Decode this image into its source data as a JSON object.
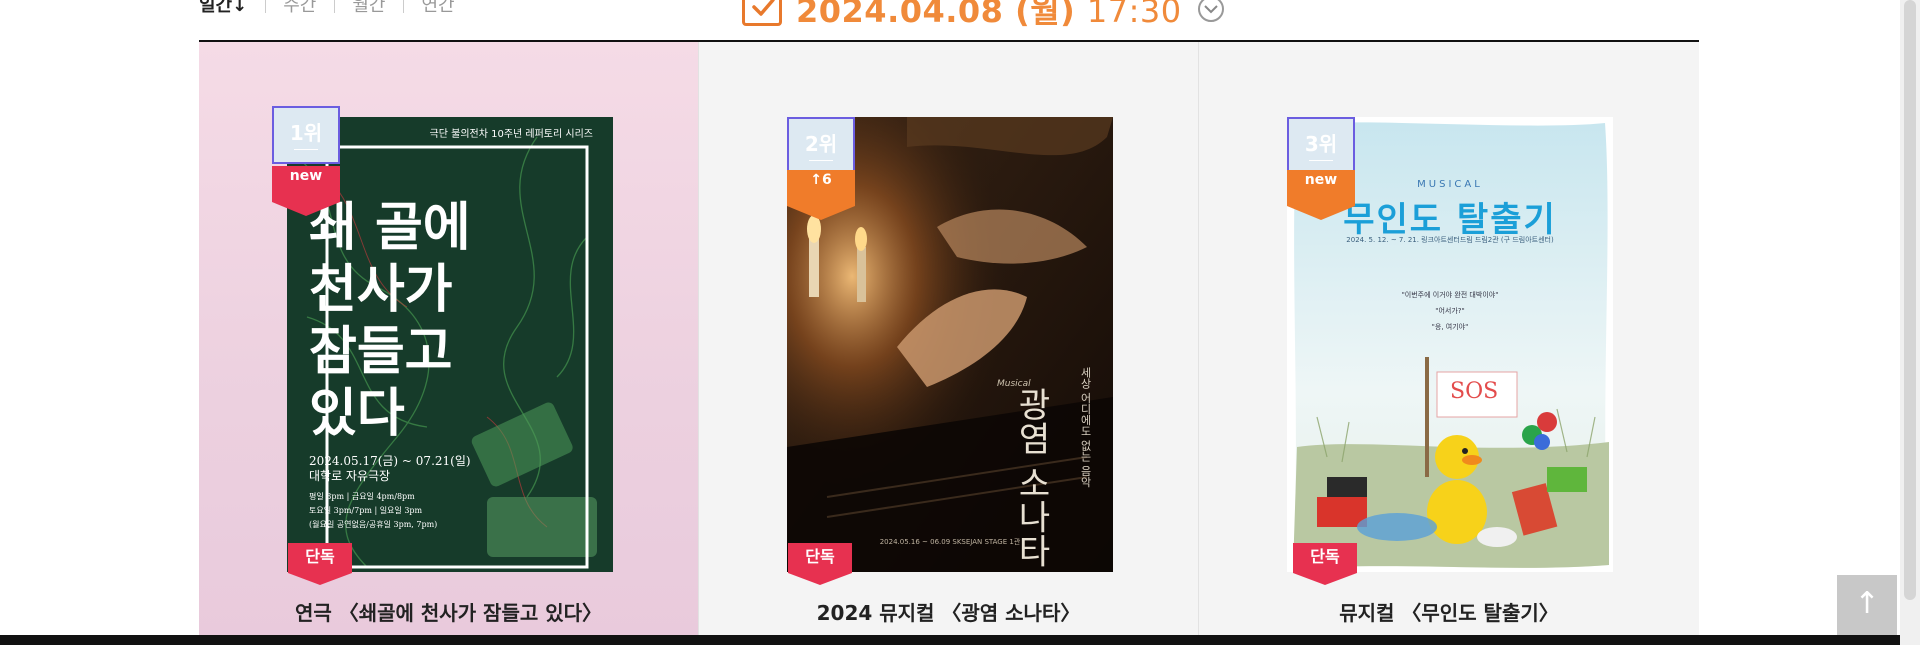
{
  "period_tabs": [
    "일간↓",
    "주간",
    "월간",
    "연간"
  ],
  "date_display": {
    "date": "2024.04.08 (월)",
    "time": "17:30"
  },
  "cards": [
    {
      "rank": "1위",
      "badge": "new",
      "badge_color": "#e73150",
      "exclusive": "단독",
      "title": "연극 〈쇄골에 천사가 잠들고 있다〉",
      "poster": {
        "header": "극단 불의전차 10주년 레퍼토리 시리즈",
        "lines": [
          "쇄 골에",
          "천사가",
          "잠들고",
          "있다"
        ],
        "period": "2024.05.17(금) ~ 07.21(일)",
        "venue": "대학로 자유극장",
        "schedule": [
          "평일 8pm | 금요일 4pm/8pm",
          "토요일 3pm/7pm | 일요일 3pm",
          "(월요일 공연없음/공휴일 3pm, 7pm)"
        ]
      }
    },
    {
      "rank": "2위",
      "badge": "↑6",
      "badge_color": "#f07c2a",
      "exclusive": "단독",
      "title": "2024 뮤지컬 〈광염 소나타〉",
      "poster": {
        "side_text": "세상 어디에도 없는 음악",
        "lines": [
          "광염",
          "소나타"
        ],
        "musical_tag": "Musical",
        "footer": "2024.05.16 ~ 06.09  SKSEJAN STAGE 1관"
      }
    },
    {
      "rank": "3위",
      "badge": "new",
      "badge_color": "#f07c2a",
      "exclusive": "단독",
      "title": "뮤지컬 〈무인도 탈출기〉",
      "poster": {
        "tag": "MUSICAL",
        "heading": "무인도 탈출기",
        "period": "2024. 5. 12. ~ 7. 21.  링크아트센터드림 드림2관 (구 드림아트센터)",
        "quotes": [
          "\"이번주에 이거야 완전 대박이야\"",
          "\"어서가?\"",
          "\"응, 여기야\""
        ],
        "sign": "SOS"
      }
    }
  ],
  "scroll_top_label": "↑"
}
